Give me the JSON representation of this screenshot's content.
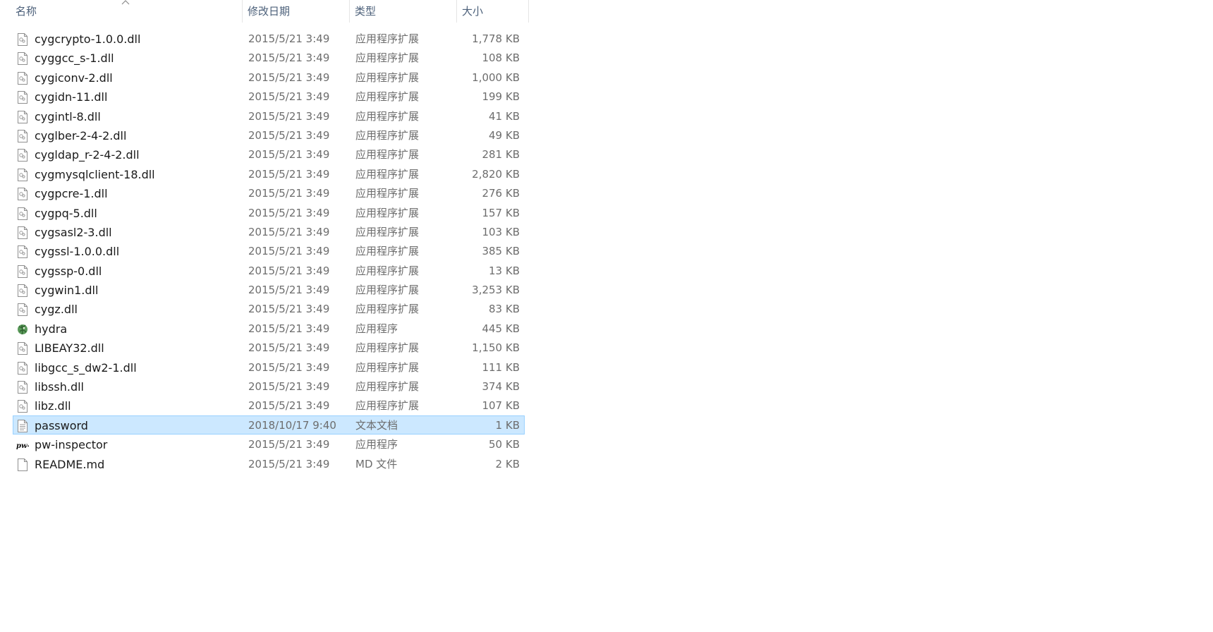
{
  "columns": {
    "name": "名称",
    "date": "修改日期",
    "type": "类型",
    "size": "大小"
  },
  "files": [
    {
      "name": "cygcrypto-1.0.0.dll",
      "date": "2015/5/21 3:49",
      "type": "应用程序扩展",
      "size": "1,778 KB",
      "icon": "dll-file-icon"
    },
    {
      "name": "cyggcc_s-1.dll",
      "date": "2015/5/21 3:49",
      "type": "应用程序扩展",
      "size": "108 KB",
      "icon": "dll-file-icon"
    },
    {
      "name": "cygiconv-2.dll",
      "date": "2015/5/21 3:49",
      "type": "应用程序扩展",
      "size": "1,000 KB",
      "icon": "dll-file-icon"
    },
    {
      "name": "cygidn-11.dll",
      "date": "2015/5/21 3:49",
      "type": "应用程序扩展",
      "size": "199 KB",
      "icon": "dll-file-icon"
    },
    {
      "name": "cygintl-8.dll",
      "date": "2015/5/21 3:49",
      "type": "应用程序扩展",
      "size": "41 KB",
      "icon": "dll-file-icon"
    },
    {
      "name": "cyglber-2-4-2.dll",
      "date": "2015/5/21 3:49",
      "type": "应用程序扩展",
      "size": "49 KB",
      "icon": "dll-file-icon"
    },
    {
      "name": "cygldap_r-2-4-2.dll",
      "date": "2015/5/21 3:49",
      "type": "应用程序扩展",
      "size": "281 KB",
      "icon": "dll-file-icon"
    },
    {
      "name": "cygmysqlclient-18.dll",
      "date": "2015/5/21 3:49",
      "type": "应用程序扩展",
      "size": "2,820 KB",
      "icon": "dll-file-icon"
    },
    {
      "name": "cygpcre-1.dll",
      "date": "2015/5/21 3:49",
      "type": "应用程序扩展",
      "size": "276 KB",
      "icon": "dll-file-icon"
    },
    {
      "name": "cygpq-5.dll",
      "date": "2015/5/21 3:49",
      "type": "应用程序扩展",
      "size": "157 KB",
      "icon": "dll-file-icon"
    },
    {
      "name": "cygsasl2-3.dll",
      "date": "2015/5/21 3:49",
      "type": "应用程序扩展",
      "size": "103 KB",
      "icon": "dll-file-icon"
    },
    {
      "name": "cygssl-1.0.0.dll",
      "date": "2015/5/21 3:49",
      "type": "应用程序扩展",
      "size": "385 KB",
      "icon": "dll-file-icon"
    },
    {
      "name": "cygssp-0.dll",
      "date": "2015/5/21 3:49",
      "type": "应用程序扩展",
      "size": "13 KB",
      "icon": "dll-file-icon"
    },
    {
      "name": "cygwin1.dll",
      "date": "2015/5/21 3:49",
      "type": "应用程序扩展",
      "size": "3,253 KB",
      "icon": "dll-file-icon"
    },
    {
      "name": "cygz.dll",
      "date": "2015/5/21 3:49",
      "type": "应用程序扩展",
      "size": "83 KB",
      "icon": "dll-file-icon"
    },
    {
      "name": "hydra",
      "date": "2015/5/21 3:49",
      "type": "应用程序",
      "size": "445 KB",
      "icon": "hydra-app-icon"
    },
    {
      "name": "LIBEAY32.dll",
      "date": "2015/5/21 3:49",
      "type": "应用程序扩展",
      "size": "1,150 KB",
      "icon": "dll-file-icon"
    },
    {
      "name": "libgcc_s_dw2-1.dll",
      "date": "2015/5/21 3:49",
      "type": "应用程序扩展",
      "size": "111 KB",
      "icon": "dll-file-icon"
    },
    {
      "name": "libssh.dll",
      "date": "2015/5/21 3:49",
      "type": "应用程序扩展",
      "size": "374 KB",
      "icon": "dll-file-icon"
    },
    {
      "name": "libz.dll",
      "date": "2015/5/21 3:49",
      "type": "应用程序扩展",
      "size": "107 KB",
      "icon": "dll-file-icon"
    },
    {
      "name": "password",
      "date": "2018/10/17 9:40",
      "type": "文本文档",
      "size": "1 KB",
      "icon": "text-file-icon",
      "selected": true
    },
    {
      "name": "pw-inspector",
      "date": "2015/5/21 3:49",
      "type": "应用程序",
      "size": "50 KB",
      "icon": "pw-inspector-app-icon"
    },
    {
      "name": "README.md",
      "date": "2015/5/21 3:49",
      "type": "MD 文件",
      "size": "2 KB",
      "icon": "blank-file-icon"
    }
  ],
  "colors": {
    "selection_bg": "#cce8ff",
    "selection_border": "#99d1ff",
    "header_text": "#4c607a",
    "secondary_text": "#6d6d6d"
  }
}
